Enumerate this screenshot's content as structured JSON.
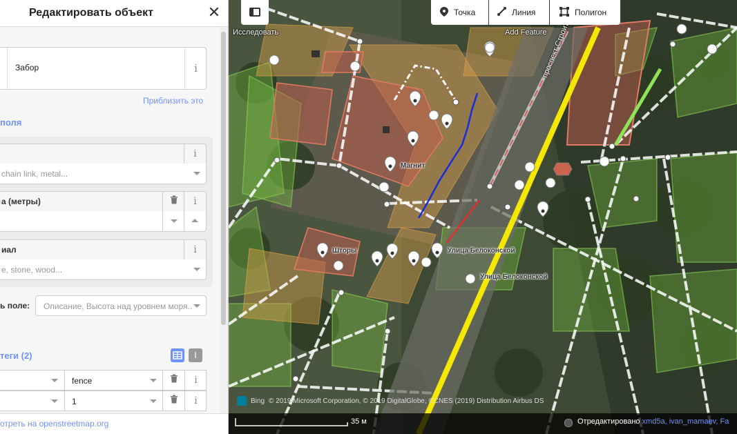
{
  "sidebar": {
    "title": "Редактировать объект",
    "close_icon": "✕",
    "preset_label": "Забор",
    "zoom_link": "Приблизить это",
    "fields_heading": "поля",
    "fields": [
      {
        "label": "",
        "placeholder": "chain link, metal..."
      },
      {
        "label": "а (метры)",
        "placeholder": ""
      },
      {
        "label": "иал",
        "placeholder": "e, stone, wood..."
      }
    ],
    "add_field_label": "ь поле:",
    "add_field_placeholder": "Описание, Высота над уровнем моря...",
    "tags_heading": "теги (2)",
    "tags": [
      {
        "key": "",
        "value": "fence"
      },
      {
        "key": "",
        "value": "1"
      }
    ],
    "footer_link": "отреть на openstreetmap.org"
  },
  "toolbar": {
    "explore_label": "Исследовать",
    "add_feature_label": "Add Feature",
    "point_label": "Точка",
    "line_label": "Линия",
    "polygon_label": "Полигон"
  },
  "map": {
    "street_label": "проспект Строителей",
    "poi_labels": [
      "Магнит",
      "Шторы",
      "Улица Белоконской",
      "Улица Белоконской"
    ],
    "attribution_bing": "Bing",
    "attribution": "© 2019 Microsoft Corporation, © 2019 DigitalGlobe, ©CNES (2019) Distribution Airbus DS",
    "scale_label": "35 м",
    "edited_by_label": "Отредактировано",
    "edited_by_users": "xmd5a, ivan_mamaev, Fa"
  },
  "colors": {
    "accent": "#7092ff",
    "road_yellow": "#f4e800",
    "selected_red": "#e03030",
    "line_blue": "#1a2bdc"
  }
}
